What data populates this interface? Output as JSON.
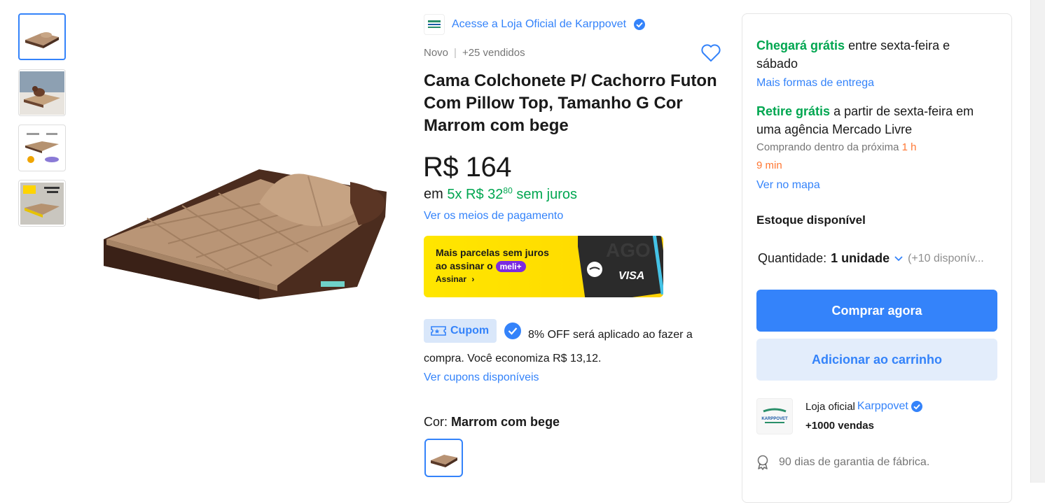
{
  "gallery": {
    "thumbnails": [
      "thumb-1",
      "thumb-2",
      "thumb-3",
      "thumb-4"
    ],
    "selected_index": 0
  },
  "store": {
    "link_text": "Acesse a Loja Oficial de Karppovet"
  },
  "product": {
    "condition": "Novo",
    "separator": "|",
    "sold": "+25 vendidos",
    "title": "Cama Colchonete P/ Cachorro Futon Com Pillow Top, Tamanho G Cor Marrom com bege",
    "price": "R$ 164",
    "installment_prefix": "em",
    "installment_value": "5x R$ 32",
    "installment_cents": "80",
    "installment_suffix": "sem juros",
    "payment_link": "Ver os meios de pagamento"
  },
  "banner": {
    "line1": "Mais parcelas sem juros",
    "line2": "ao assinar o",
    "badge": "meli+",
    "cta": "Assinar",
    "card_brand": "VISA"
  },
  "coupon": {
    "badge": "Cupom",
    "text": "8% OFF será aplicado ao fazer a compra. Você economiza R$ 13,12.",
    "link": "Ver cupons disponíveis"
  },
  "variant": {
    "label": "Cor:",
    "value": "Marrom com bege"
  },
  "shipping": {
    "highlight": "Chegará grátis",
    "text": "entre sexta-feira e sábado",
    "link": "Mais formas de entrega"
  },
  "pickup": {
    "highlight": "Retire grátis",
    "text": "a partir de sexta-feira em uma agência Mercado Livre",
    "countdown_prefix": "Comprando dentro da próxima",
    "countdown_1": "1 h",
    "countdown_2": "9 min",
    "map_link": "Ver no mapa"
  },
  "stock": {
    "title": "Estoque disponível",
    "qty_label": "Quantidade:",
    "qty_value": "1 unidade",
    "available": "(+10 disponív..."
  },
  "actions": {
    "buy": "Comprar agora",
    "cart": "Adicionar ao carrinho"
  },
  "seller": {
    "prefix": "Loja oficial",
    "name": "Karppovet",
    "sales": "+1000 vendas",
    "logo_text": "KARPPOVET"
  },
  "warranty": {
    "text": "90 dias de garantia de fábrica."
  },
  "colors": {
    "accent": "#3483fa",
    "green": "#00a650",
    "orange": "#ff7733"
  }
}
